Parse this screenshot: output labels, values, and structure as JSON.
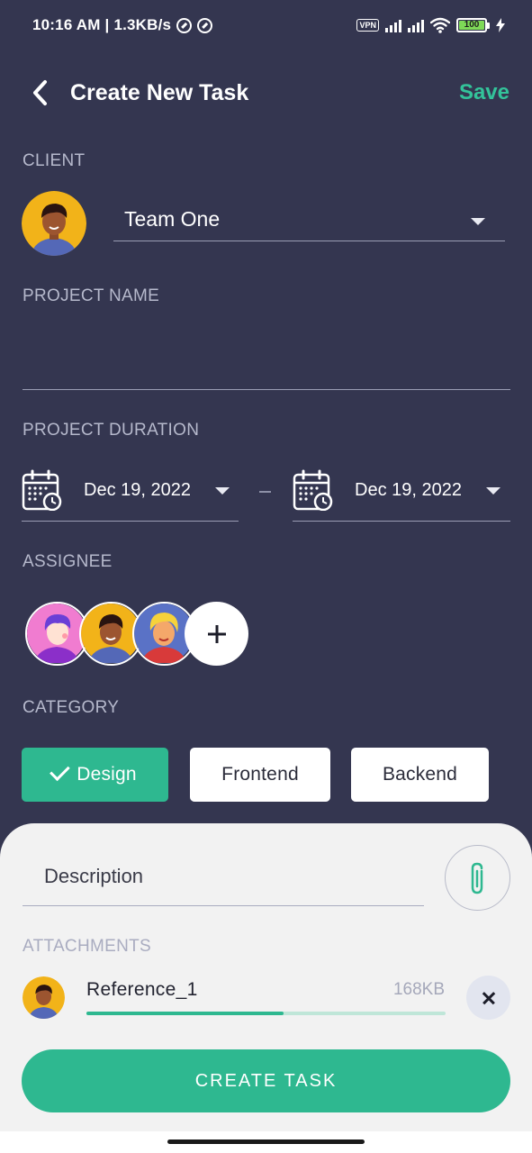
{
  "status_bar": {
    "time": "10:16 AM",
    "speed": "1.3KB/s",
    "vpn": "VPN",
    "battery": "100",
    "icons": [
      "sync-icon",
      "sync-icon",
      "vpn-icon",
      "signal-icon",
      "signal-icon",
      "wifi-icon",
      "battery-icon",
      "charging-icon"
    ]
  },
  "header": {
    "back_icon": "chevron-left-icon",
    "title": "Create New Task",
    "save_label": "Save"
  },
  "client": {
    "label": "CLIENT",
    "selected": "Team One",
    "avatar_icon": "person-avatar-icon"
  },
  "project_name": {
    "label": "PROJECT NAME",
    "value": ""
  },
  "duration": {
    "label": "PROJECT DURATION",
    "start": "Dec 19, 2022",
    "end": "Dec 19, 2022",
    "icon": "calendar-clock-icon"
  },
  "assignee": {
    "label": "ASSIGNEE",
    "avatars": [
      "purple-hair-avatar",
      "dark-hair-avatar",
      "blonde-avatar"
    ],
    "add_icon": "plus-icon"
  },
  "category": {
    "label": "CATEGORY",
    "options": [
      {
        "label": "Design",
        "selected": true
      },
      {
        "label": "Frontend",
        "selected": false
      },
      {
        "label": "Backend",
        "selected": false
      }
    ]
  },
  "description": {
    "placeholder": "Description",
    "attach_icon": "paperclip-icon"
  },
  "attachments": {
    "label": "ATTACHMENTS",
    "items": [
      {
        "name": "Reference_1",
        "size": "168KB",
        "progress": 0.55
      }
    ]
  },
  "create_label": "CREATE TASK",
  "colors": {
    "background": "#343650",
    "accent": "#2eb890",
    "sheet": "#f2f2f2"
  }
}
